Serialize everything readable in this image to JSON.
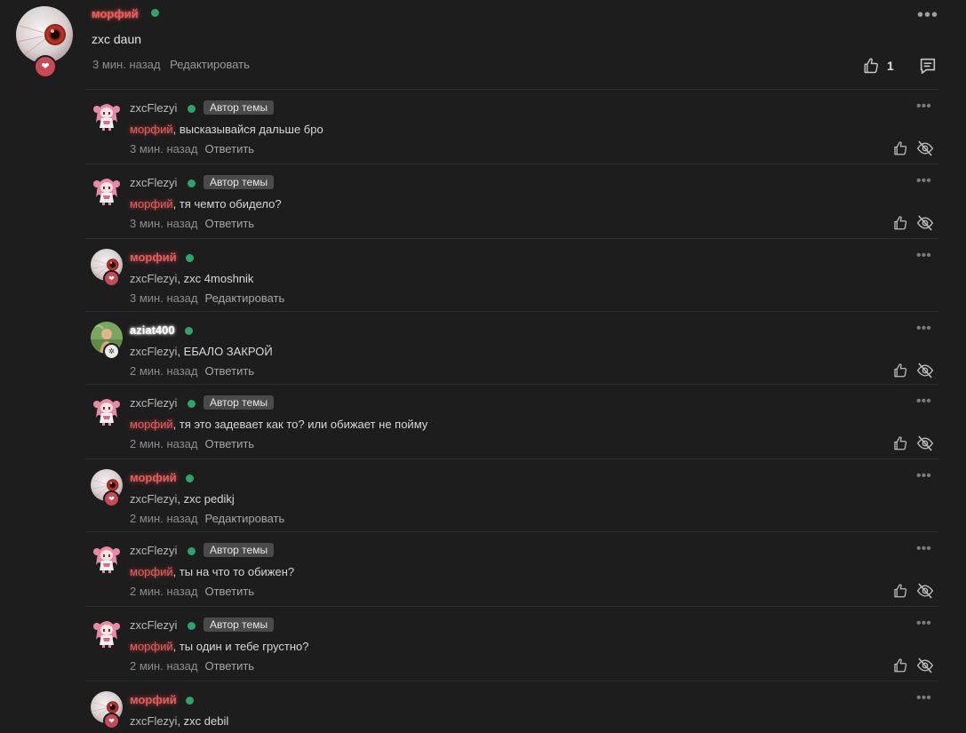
{
  "main_post": {
    "author": "морфий",
    "text": "zxc daun",
    "time": "3 мин. назад",
    "action": "Редактировать",
    "likes": "1",
    "more": "•••"
  },
  "replies": [
    {
      "author": "zxcFlezyi",
      "tag": "Автор темы",
      "mention": "морфий",
      "text": ", высказывайся дальше бро",
      "time": "3 мин. назад",
      "action": "Ответить"
    },
    {
      "author": "zxcFlezyi",
      "tag": "Автор темы",
      "mention": "морфий",
      "text": ", тя чемто обидело?",
      "time": "3 мин. назад",
      "action": "Ответить"
    },
    {
      "author": "морфий",
      "mention": "zxcFlezyi",
      "text": ", zxc 4moshnik",
      "time": "3 мин. назад",
      "action": "Редактировать"
    },
    {
      "author": "aziat400",
      "mention": "zxcFlezyi",
      "text": ", ЕБАЛО ЗАКРОЙ",
      "time": "2 мин. назад",
      "action": "Ответить"
    },
    {
      "author": "zxcFlezyi",
      "tag": "Автор темы",
      "mention": "морфий",
      "text": ", тя это задевает как то? или обижает не пойму",
      "time": "2 мин. назад",
      "action": "Ответить"
    },
    {
      "author": "морфий",
      "mention": "zxcFlezyi",
      "text": ", zxc pedikj",
      "time": "2 мин. назад",
      "action": "Редактировать"
    },
    {
      "author": "zxcFlezyi",
      "tag": "Автор темы",
      "mention": "морфий",
      "text": ", ты на что то обижен?",
      "time": "2 мин. назад",
      "action": "Ответить"
    },
    {
      "author": "zxcFlezyi",
      "tag": "Автор темы",
      "mention": "морфий",
      "text": ", ты один и тебе грустно?",
      "time": "2 мин. назад",
      "action": "Ответить"
    },
    {
      "author": "морфий",
      "mention": "zxcFlezyi",
      "text": ", zxc debil",
      "time": "",
      "action": ""
    }
  ],
  "colors": {
    "background": "#1d1d1d",
    "online": "#2fa36b",
    "highlight_name": "#e06060",
    "tag_bg": "#4a4a4a"
  },
  "icons": [
    "eye-avatar",
    "heart-badge",
    "thumbs-up-icon",
    "comment-icon",
    "eye-off-icon",
    "more-icon",
    "anime-girl-avatar",
    "leaf-badge"
  ]
}
